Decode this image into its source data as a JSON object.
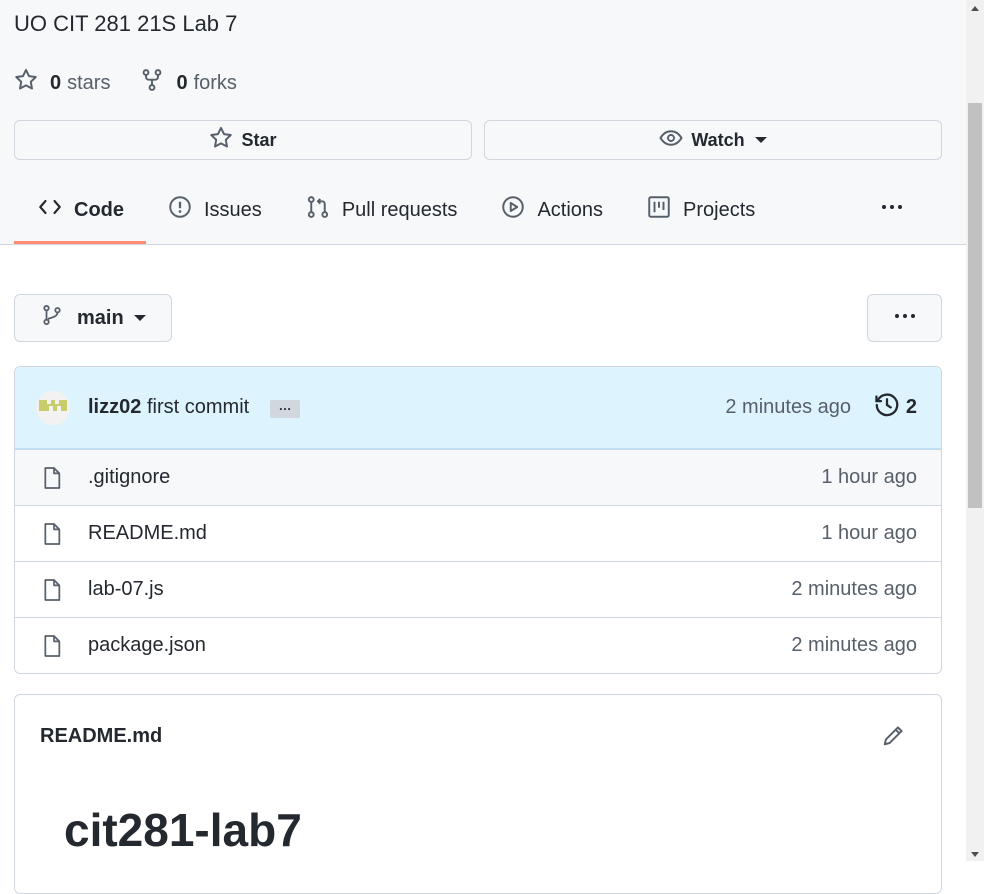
{
  "repo": {
    "description": "UO CIT 281 21S Lab 7",
    "stars_count": "0",
    "stars_label": "stars",
    "forks_count": "0",
    "forks_label": "forks"
  },
  "buttons": {
    "star": "Star",
    "watch": "Watch"
  },
  "tabs": [
    {
      "label": "Code",
      "icon": "code-icon",
      "active": true
    },
    {
      "label": "Issues",
      "icon": "issue-icon"
    },
    {
      "label": "Pull requests",
      "icon": "pull-request-icon"
    },
    {
      "label": "Actions",
      "icon": "play-icon"
    },
    {
      "label": "Projects",
      "icon": "project-icon"
    }
  ],
  "branch": {
    "name": "main"
  },
  "commit": {
    "author": "lizz02",
    "message": "first commit",
    "time": "2 minutes ago",
    "count": "2"
  },
  "files": [
    {
      "name": ".gitignore",
      "time": "1 hour ago"
    },
    {
      "name": "README.md",
      "time": "1 hour ago"
    },
    {
      "name": "lab-07.js",
      "time": "2 minutes ago"
    },
    {
      "name": "package.json",
      "time": "2 minutes ago"
    }
  ],
  "readme": {
    "title": "README.md",
    "heading": "cit281-lab7"
  },
  "colors": {
    "accent_underline": "#fd8c73",
    "commit_bg": "#ddf4ff",
    "border": "#d0d7de"
  }
}
